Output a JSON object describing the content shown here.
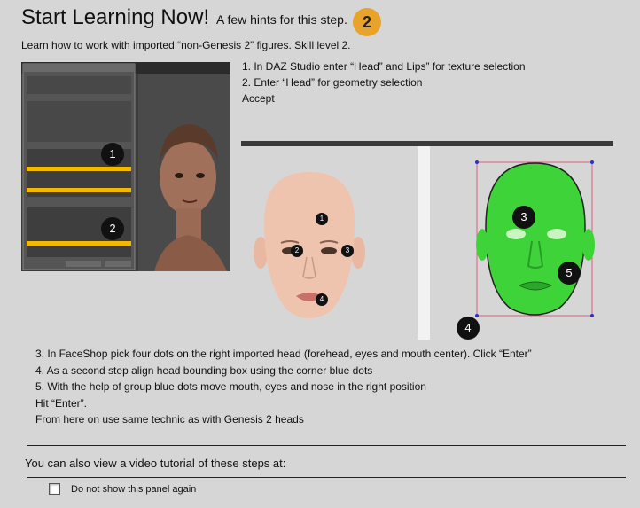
{
  "header": {
    "title": "Start Learning Now!",
    "subtitle": "A few hints for this step.",
    "step_badge": "2"
  },
  "intro": "Learn how to work with imported “non-Genesis 2” figures. Skill level 2.",
  "steps_top": [
    "1. In DAZ Studio enter “Head” and Lips” for texture selection",
    "2. Enter “Head” for geometry selection",
    "Accept"
  ],
  "screenshot_markers": [
    "1",
    "2"
  ],
  "face_markers": [
    "1",
    "2",
    "3",
    "4"
  ],
  "green_head_markers": [
    "3",
    "4",
    "5"
  ],
  "steps_bottom": [
    "3. In FaceShop pick four dots on the right imported head (forehead, eyes and mouth center). Click “Enter”",
    "4. As a second step align head bounding box using the corner blue dots",
    "5. With the help of group blue dots move mouth, eyes and nose in the right position",
    "Hit “Enter”.",
    "From here on use same technic as with Genesis 2 heads"
  ],
  "video_text": "You can also view a video tutorial of these steps at:",
  "checkbox_label": "Do not show this panel again",
  "colors": {
    "background": "#d6d6d6",
    "badge": "#e8a32c",
    "highlight": "#f5b800",
    "green_head": "#3fd33a"
  }
}
